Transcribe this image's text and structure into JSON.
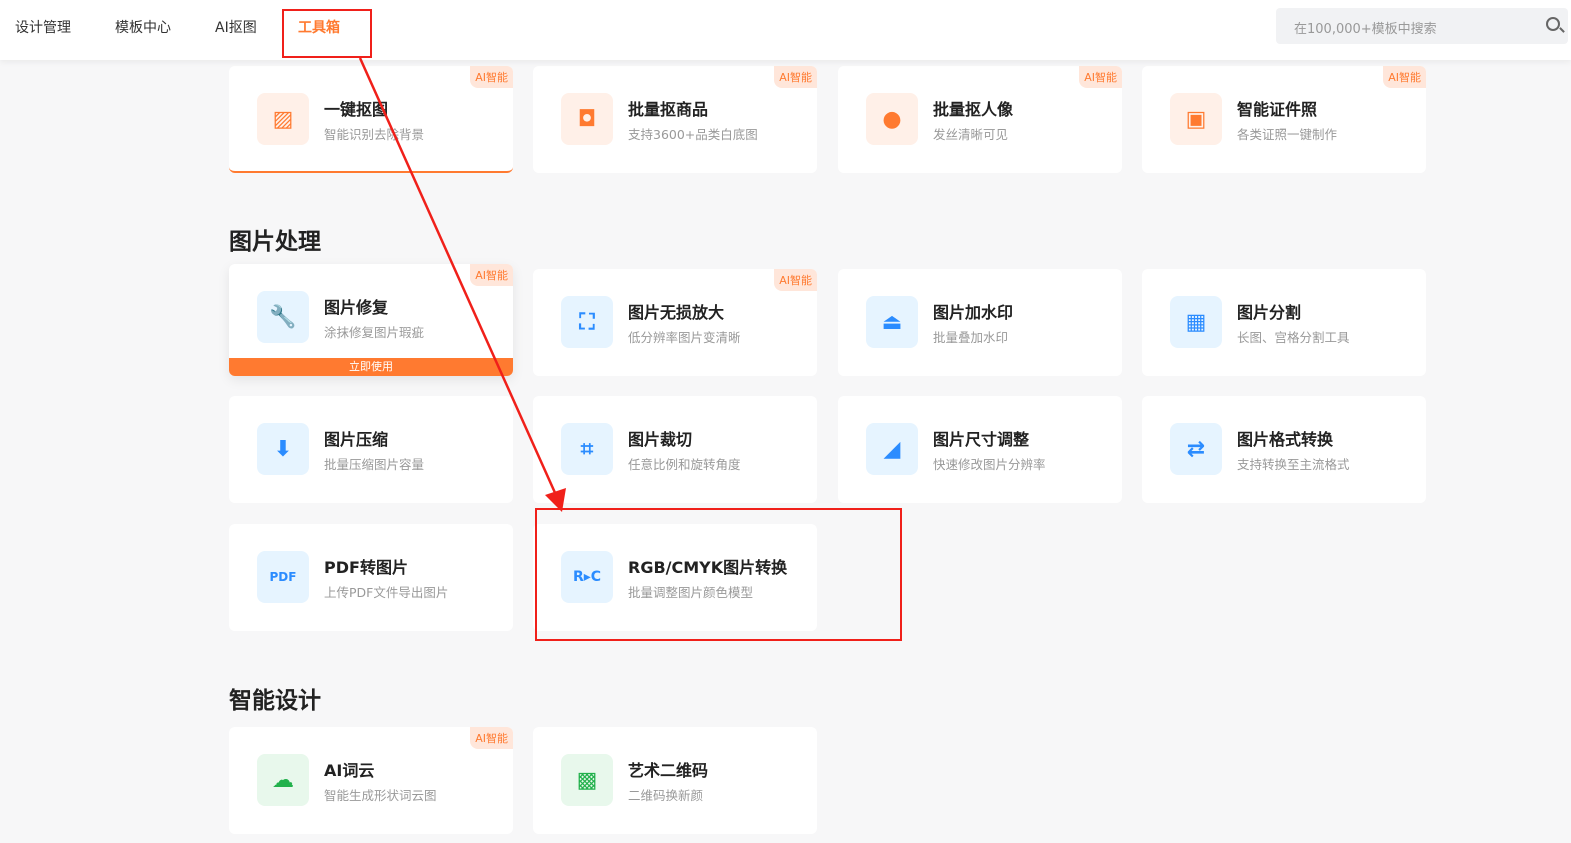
{
  "nav": {
    "items": [
      "设计管理",
      "模板中心",
      "AI抠图",
      "工具箱"
    ],
    "search_placeholder": "在100,000+模板中搜索"
  },
  "badge": "AI智能",
  "use_now": "立即使用",
  "sections": {
    "image": "图片处理",
    "smart": "智能设计"
  },
  "top_cards": [
    {
      "title": "一键抠图",
      "desc": "智能识别去除背景",
      "icon": "cutout-icon",
      "ai": true
    },
    {
      "title": "批量抠商品",
      "desc": "支持3600+品类白底图",
      "icon": "shopping-bag-icon",
      "ai": true
    },
    {
      "title": "批量抠人像",
      "desc": "发丝清晰可见",
      "icon": "person-icon",
      "ai": true
    },
    {
      "title": "智能证件照",
      "desc": "各类证照一键制作",
      "icon": "id-photo-icon",
      "ai": true
    }
  ],
  "image_cards": [
    {
      "title": "图片修复",
      "desc": "涂抹修复图片瑕疵",
      "icon": "wrench-icon",
      "ai": true
    },
    {
      "title": "图片无损放大",
      "desc": "低分辨率图片变清晰",
      "icon": "enlarge-icon",
      "ai": true
    },
    {
      "title": "图片加水印",
      "desc": "批量叠加水印",
      "icon": "stamp-icon"
    },
    {
      "title": "图片分割",
      "desc": "长图、宫格分割工具",
      "icon": "grid-icon"
    },
    {
      "title": "图片压缩",
      "desc": "批量压缩图片容量",
      "icon": "compress-icon"
    },
    {
      "title": "图片裁切",
      "desc": "任意比例和旋转角度",
      "icon": "crop-icon"
    },
    {
      "title": "图片尺寸调整",
      "desc": "快速修改图片分辨率",
      "icon": "ruler-icon"
    },
    {
      "title": "图片格式转换",
      "desc": "支持转换至主流格式",
      "icon": "format-convert-icon"
    },
    {
      "title": "PDF转图片",
      "desc": "上传PDF文件导出图片",
      "icon": "pdf-icon"
    },
    {
      "title": "RGB/CMYK图片转换",
      "desc": "批量调整图片颜色模型",
      "icon": "rgb-cmyk-icon"
    }
  ],
  "smart_cards": [
    {
      "title": "AI词云",
      "desc": "智能生成形状词云图",
      "icon": "cloud-icon",
      "ai": true
    },
    {
      "title": "艺术二维码",
      "desc": "二维码换新颜",
      "icon": "qrcode-icon"
    }
  ]
}
